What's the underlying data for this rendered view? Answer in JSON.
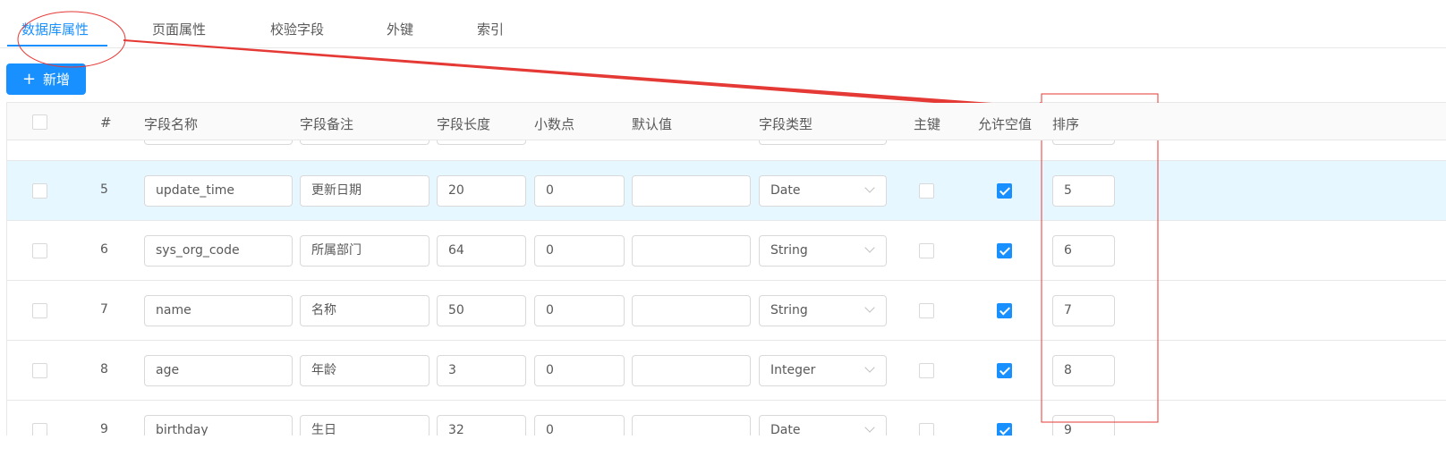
{
  "tabs": [
    {
      "label": "数据库属性",
      "active": true
    },
    {
      "label": "页面属性",
      "active": false
    },
    {
      "label": "校验字段",
      "active": false
    },
    {
      "label": "外键",
      "active": false
    },
    {
      "label": "索引",
      "active": false
    }
  ],
  "toolbar": {
    "add_label": "新增",
    "add_icon": "plus-icon"
  },
  "table": {
    "headers": [
      "#",
      "字段名称",
      "字段备注",
      "字段长度",
      "小数点",
      "默认值",
      "字段类型",
      "主键",
      "允许空值",
      "排序"
    ],
    "rows": [
      {
        "index": "5",
        "name": "update_time",
        "comment": "更新日期",
        "length": "20",
        "decimal": "0",
        "default": "",
        "type": "Date",
        "primary": false,
        "nullable": true,
        "order": "5",
        "highlighted": true
      },
      {
        "index": "6",
        "name": "sys_org_code",
        "comment": "所属部门",
        "length": "64",
        "decimal": "0",
        "default": "",
        "type": "String",
        "primary": false,
        "nullable": true,
        "order": "6",
        "highlighted": false
      },
      {
        "index": "7",
        "name": "name",
        "comment": "名称",
        "length": "50",
        "decimal": "0",
        "default": "",
        "type": "String",
        "primary": false,
        "nullable": true,
        "order": "7",
        "highlighted": false
      },
      {
        "index": "8",
        "name": "age",
        "comment": "年龄",
        "length": "3",
        "decimal": "0",
        "default": "",
        "type": "Integer",
        "primary": false,
        "nullable": true,
        "order": "8",
        "highlighted": false
      },
      {
        "index": "9",
        "name": "birthday",
        "comment": "生日",
        "length": "32",
        "decimal": "0",
        "default": "",
        "type": "Date",
        "primary": false,
        "nullable": true,
        "order": "9",
        "highlighted": false
      }
    ]
  },
  "colors": {
    "accent": "#1890ff",
    "annotation": "#e53935",
    "row_highlight": "#e6f7ff"
  }
}
